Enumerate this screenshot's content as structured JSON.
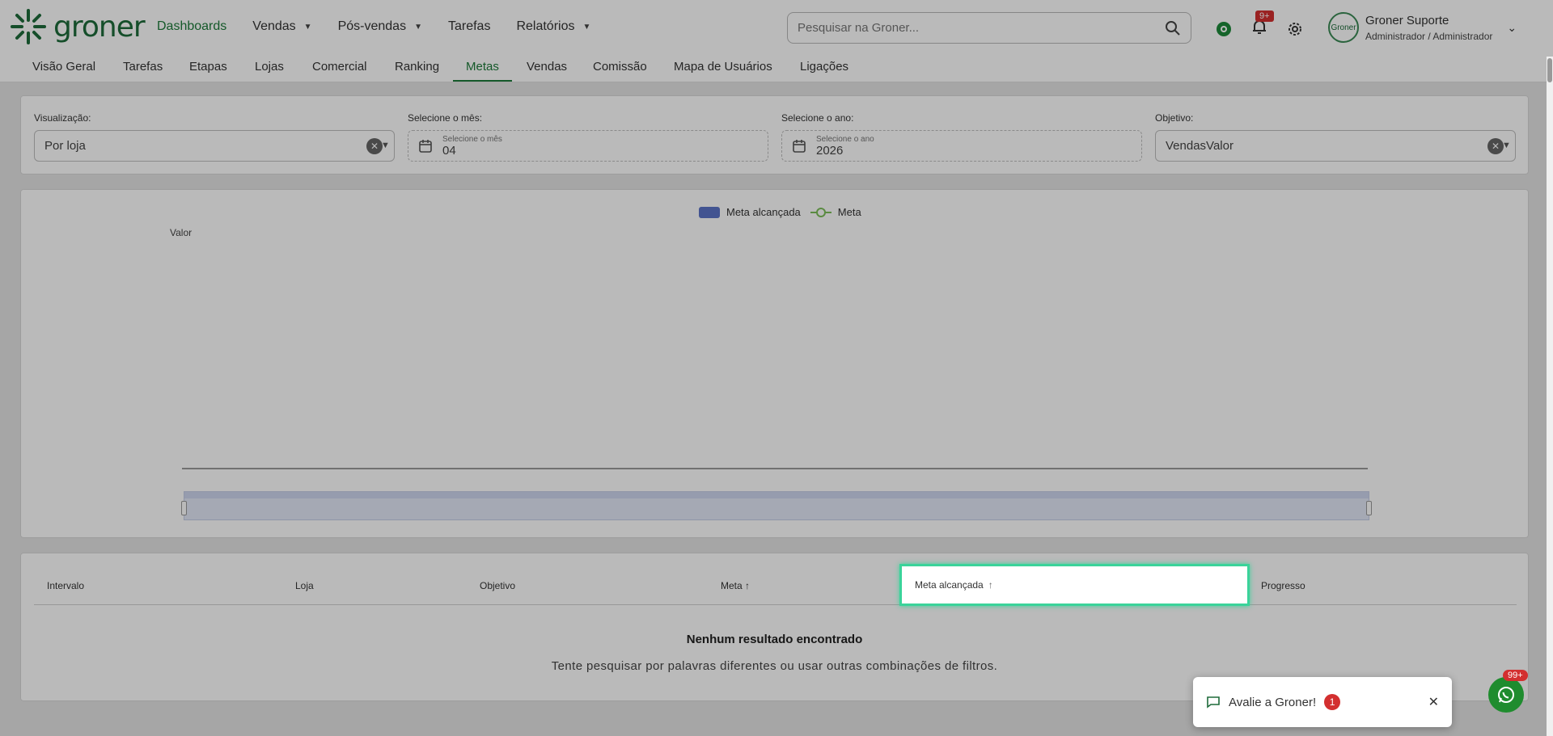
{
  "brand": {
    "name": "groner",
    "color": "#1e6b3a"
  },
  "nav": [
    {
      "label": "Dashboards",
      "active": true,
      "dropdown": false
    },
    {
      "label": "Vendas",
      "dropdown": true
    },
    {
      "label": "Pós-vendas",
      "dropdown": true
    },
    {
      "label": "Tarefas",
      "dropdown": false
    },
    {
      "label": "Relatórios",
      "dropdown": true
    }
  ],
  "search": {
    "placeholder": "Pesquisar na Groner..."
  },
  "notifications": {
    "count": "9+"
  },
  "user": {
    "name": "Groner Suporte",
    "role": "Administrador / Administrador",
    "avatar_text": "Groner"
  },
  "tabs": [
    {
      "label": "Visão Geral"
    },
    {
      "label": "Tarefas"
    },
    {
      "label": "Etapas"
    },
    {
      "label": "Lojas"
    },
    {
      "label": "Comercial"
    },
    {
      "label": "Ranking"
    },
    {
      "label": "Metas",
      "active": true
    },
    {
      "label": "Vendas"
    },
    {
      "label": "Comissão"
    },
    {
      "label": "Mapa de Usuários"
    },
    {
      "label": "Ligações"
    }
  ],
  "filters": {
    "visualizacao": {
      "label": "Visualização:",
      "value": "Por loja"
    },
    "mes": {
      "label": "Selecione o mês:",
      "sublabel": "Selecione o mês",
      "value": "04"
    },
    "ano": {
      "label": "Selecione o ano:",
      "sublabel": "Selecione o ano",
      "value": "2026"
    },
    "objetivo": {
      "label": "Objetivo:",
      "value": "VendasValor"
    }
  },
  "chart_data": {
    "type": "bar",
    "series": [
      {
        "name": "Meta alcançada",
        "type": "bar",
        "color": "#5b73c7",
        "values": []
      },
      {
        "name": "Meta",
        "type": "line",
        "color": "#7cbf5a",
        "values": []
      }
    ],
    "categories": [],
    "ylabel": "Valor",
    "legend": "top-center",
    "zoom_slider": true
  },
  "table": {
    "columns": [
      {
        "label": "Intervalo",
        "sort": ""
      },
      {
        "label": "Loja",
        "sort": ""
      },
      {
        "label": "Objetivo",
        "sort": ""
      },
      {
        "label": "Meta",
        "sort": "↑"
      },
      {
        "label": "Meta alcançada",
        "sort": "↑"
      },
      {
        "label": "Progresso",
        "sort": ""
      }
    ],
    "empty_title": "Nenhum resultado encontrado",
    "empty_subtitle": "Tente pesquisar por palavras diferentes ou usar outras combinações de filtros."
  },
  "toast": {
    "label": "Avalie a Groner!",
    "count": "1"
  },
  "whatsapp": {
    "badge": "99+"
  }
}
